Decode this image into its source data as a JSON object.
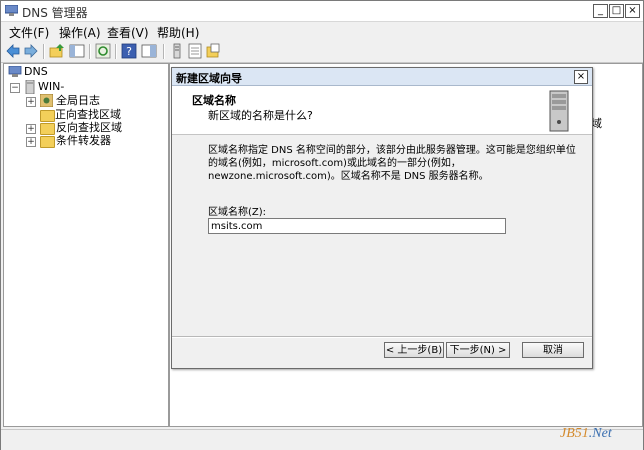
{
  "window": {
    "title": "DNS 管理器",
    "minimize": "_",
    "maximize": "□",
    "close": "×"
  },
  "menu": [
    "文件(F)",
    "操作(A)",
    "查看(V)",
    "帮助(H)"
  ],
  "tree": {
    "root": "DNS",
    "server": "WIN-",
    "items": [
      "全局日志",
      "正向查找区域",
      "反向查找区域",
      "条件转发器"
    ]
  },
  "background_text": "域",
  "dialog": {
    "title": "新建区域向导",
    "close": "×",
    "header_title": "区域名称",
    "header_subtitle": "新区域的名称是什么?",
    "description": "区域名称指定 DNS 名称空间的部分，该部分由此服务器管理。这可能是您组织单位的域名(例如，microsoft.com)或此域名的一部分(例如，newzone.microsoft.com)。区域名称不是 DNS 服务器名称。",
    "field_label": "区域名称(Z):",
    "field_value": "msits.com",
    "buttons": {
      "back": "< 上一步(B)",
      "next": "下一步(N) >",
      "cancel": "取消"
    }
  },
  "watermark": {
    "part_a": "JB51",
    "part_b": ".Net"
  },
  "colors": {
    "title_bar": "#dbe6f4",
    "folder": "#f3cf5a",
    "selection": "#3399ff"
  }
}
